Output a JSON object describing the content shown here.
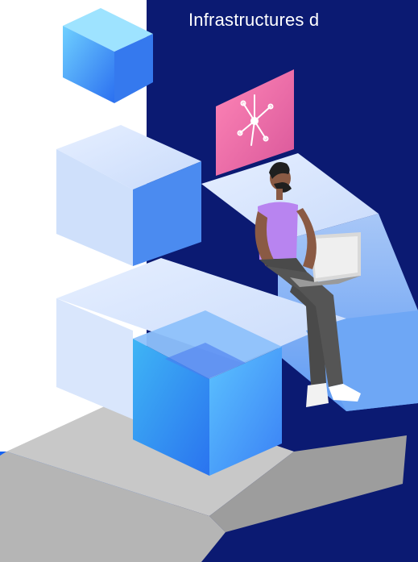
{
  "slide": {
    "title": "Infrastructures d",
    "colors": {
      "navy": "#0b1a72",
      "cube_blue": "#2f8cf0",
      "cube_light": "#cfe0fb",
      "sign_pink": "#f06fa6",
      "shirt_purple": "#b884f0",
      "pants_gray": "#4a4a4a",
      "platform_gray": "#bdbdbd",
      "floor_blue": "#1763f0"
    },
    "illustration": {
      "icons": [
        "cube-icon",
        "network-sign-icon",
        "laptop-icon",
        "person-figure"
      ]
    }
  }
}
